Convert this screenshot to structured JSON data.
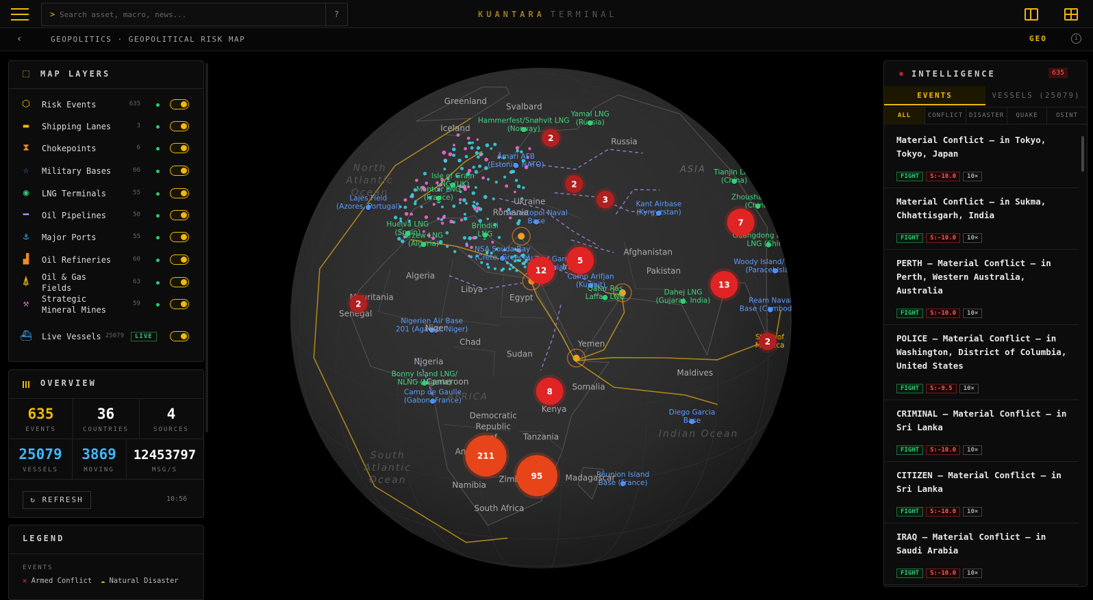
{
  "header": {
    "search_placeholder": "Search asset, macro, news...",
    "search_prompt": ">",
    "help": "?",
    "brand_primary": "KUANTARA",
    "brand_secondary": "TERMINAL"
  },
  "subbar": {
    "breadcrumb": "GEOPOLITICS · GEOPOLITICAL RISK MAP",
    "mode": "GEO"
  },
  "layers": {
    "title": "MAP LAYERS",
    "items": [
      {
        "label": "Risk Events",
        "count": "635",
        "icon": "hexagon-icon",
        "color": "#f0b90b"
      },
      {
        "label": "Shipping Lanes",
        "count": "3",
        "icon": "line-icon",
        "color": "#f0b90b"
      },
      {
        "label": "Chokepoints",
        "count": "6",
        "icon": "hourglass-icon",
        "color": "#f08a24"
      },
      {
        "label": "Military Bases",
        "count": "66",
        "icon": "star-icon",
        "color": "#4a8cff"
      },
      {
        "label": "LNG Terminals",
        "count": "55",
        "icon": "tank-icon",
        "color": "#2ecc71"
      },
      {
        "label": "Oil Pipelines",
        "count": "50",
        "icon": "pipe-icon",
        "color": "#c08cff"
      },
      {
        "label": "Major Ports",
        "count": "55",
        "icon": "anchor-icon",
        "color": "#3fb6ff"
      },
      {
        "label": "Oil Refineries",
        "count": "60",
        "icon": "factory-icon",
        "color": "#f08a24"
      },
      {
        "label": "Oil & Gas Fields",
        "count": "63",
        "icon": "derrick-icon",
        "color": "#f0b90b"
      },
      {
        "label": "Strategic Mineral Mines",
        "count": "59",
        "icon": "pickaxe-icon",
        "color": "#d070d0"
      },
      {
        "label": "Live Vessels",
        "count": "25079",
        "icon": "ship-icon",
        "color": "#3fb6ff",
        "badge": "LIVE"
      }
    ]
  },
  "overview": {
    "title": "OVERVIEW",
    "stats": [
      {
        "value": "635",
        "label": "EVENTS",
        "color": "#f0b90b"
      },
      {
        "value": "36",
        "label": "COUNTRIES",
        "color": "#ffffff"
      },
      {
        "value": "4",
        "label": "SOURCES",
        "color": "#ffffff"
      },
      {
        "value": "25079",
        "label": "VESSELS",
        "color": "#3fb6ff"
      },
      {
        "value": "3869",
        "label": "MOVING",
        "color": "#3fb6ff"
      },
      {
        "value": "12453797",
        "label": "MSG/S",
        "color": "#ffffff"
      }
    ],
    "refresh_label": "REFRESH",
    "time": "10:56"
  },
  "legend": {
    "title": "LEGEND",
    "section": "EVENTS",
    "items": [
      "Armed Conflict",
      "Natural Disaster"
    ]
  },
  "map": {
    "labels": {
      "greenland": "Greenland",
      "svalbard": "Svalbard",
      "iceland": "Iceland",
      "russia": "Russia",
      "asia": "ASIA",
      "north_atlantic": "North Atlantic Ocean",
      "ukraine": "Ukraine",
      "romania": "Romania",
      "algeria": "Algeria",
      "libya": "Libya",
      "egypt": "Egypt",
      "iraq": "Iraq",
      "afghanistan": "Afghanistan",
      "pakistan": "Pakistan",
      "mauritania": "Mauritania",
      "senegal": "Senegal",
      "niger": "Niger",
      "chad": "Chad",
      "sudan": "Sudan",
      "yemen": "Yemen",
      "nigeria": "Nigeria",
      "cameroon": "Cameroon",
      "somalia": "Somalia",
      "africa": "AFRICA",
      "drc": "Democratic Republic of the Congo",
      "kenya": "Kenya",
      "tanzania": "Tanzania",
      "maldives": "Maldives",
      "angola": "Angola",
      "namibia": "Namibia",
      "zimbabwe": "Zimbabwe",
      "madagascar": "Madagascar",
      "south_africa": "South Africa",
      "south_atlantic": "South Atlantic Ocean",
      "indian_ocean": "Indian Ocean"
    },
    "facilities": {
      "hammerfest": "Hammerfest/Snøhvit LNG (Norway)",
      "yamal": "Yamal LNG (Russia)",
      "amari": "Ämari AFB (Estonia, NATO)",
      "isle_grain": "Isle of Grain LNG (UK)",
      "montoir": "Montoir LNG (France)",
      "lajes": "Lajes Field (Azores, Portugal)",
      "huelva": "Huelva LNG (Spain)",
      "arzew": "Arzew LNG (Algeria)",
      "brindisi": "Brindisi LNG",
      "sevastopol": "Sevastopol Naval Base",
      "kant": "Kant Airbase (Kyrgyzstan)",
      "tianjin": "Tianjin LNG (China)",
      "zhoushan": "Zhoushan LNG (China)",
      "guangdong": "Guangdong Dapeng LNG (China)",
      "woody": "Woody Island/Yongxing (Paracel Islands)",
      "nsa_souda": "NSA Souda Bay (Crete, Greece)",
      "al_tanf": "Al-Tanf Garrison (Syria)",
      "camp_arifjan": "Camp Arifjan (Kuwait)",
      "ras_laffan": "Qatar Ras Laffan LNG",
      "dahej": "Dahej LNG (Gujarat, India)",
      "ream": "Ream Naval Base (Cambodia)",
      "malacca": "Strait of Malacca",
      "nigerien": "Nigerien Air Base 201 (Agadez, Niger)",
      "bonny": "Bonny Island LNG/ NLNG (Nigeria)",
      "gaulle": "Camp de Gaulle (Gabon, France)",
      "diego": "Diego Garcia Base",
      "reunion": "Réunion Island Base (France)"
    },
    "clusters": [
      {
        "count": "2",
        "lon": 41,
        "lat": 68
      },
      {
        "count": "2",
        "lon": 48,
        "lat": 54
      },
      {
        "count": "3",
        "lon": 58,
        "lat": 49
      },
      {
        "count": "5",
        "lon": 46,
        "lat": 35
      },
      {
        "count": "12",
        "lon": 35,
        "lat": 33
      },
      {
        "count": "7",
        "lon": 105,
        "lat": 32
      },
      {
        "count": "13",
        "lon": 87,
        "lat": 22
      },
      {
        "count": "2",
        "lon": 100,
        "lat": 4
      },
      {
        "count": "2",
        "lon": -15,
        "lat": 18
      },
      {
        "count": "8",
        "lon": 37,
        "lat": 5
      },
      {
        "count": "211",
        "lon": 22,
        "lat": -12
      },
      {
        "count": "95",
        "lon": 34,
        "lat": -17
      }
    ]
  },
  "intel": {
    "title": "INTELLIGENCE",
    "count": "635",
    "tabs": [
      "EVENTS",
      "VESSELS (25079)"
    ],
    "filters": [
      "ALL",
      "CONFLICT",
      "DISASTER",
      "QUAKE",
      "OSINT"
    ],
    "events": [
      {
        "title": "Material Conflict — in Tokyo, Tokyo, Japan",
        "tag": "FIGHT",
        "score": "S:-10.0",
        "mult": "10×"
      },
      {
        "title": "Material Conflict — in Sukma, Chhattisgarh, India",
        "tag": "FIGHT",
        "score": "S:-10.0",
        "mult": "10×"
      },
      {
        "title": "PERTH — Material Conflict — in Perth, Western Australia, Australia",
        "tag": "FIGHT",
        "score": "S:-10.0",
        "mult": "10×"
      },
      {
        "title": "POLICE — Material Conflict — in Washington, District of Columbia, United States",
        "tag": "FIGHT",
        "score": "S:-9.5",
        "mult": "10×"
      },
      {
        "title": "CRIMINAL — Material Conflict — in Sri Lanka",
        "tag": "FIGHT",
        "score": "S:-10.0",
        "mult": "10×"
      },
      {
        "title": "CITIZEN — Material Conflict — in Sri Lanka",
        "tag": "FIGHT",
        "score": "S:-10.0",
        "mult": "10×"
      },
      {
        "title": "IRAQ — Material Conflict — in Saudi Arabia",
        "tag": "FIGHT",
        "score": "S:-10.0",
        "mult": "10×"
      }
    ]
  }
}
